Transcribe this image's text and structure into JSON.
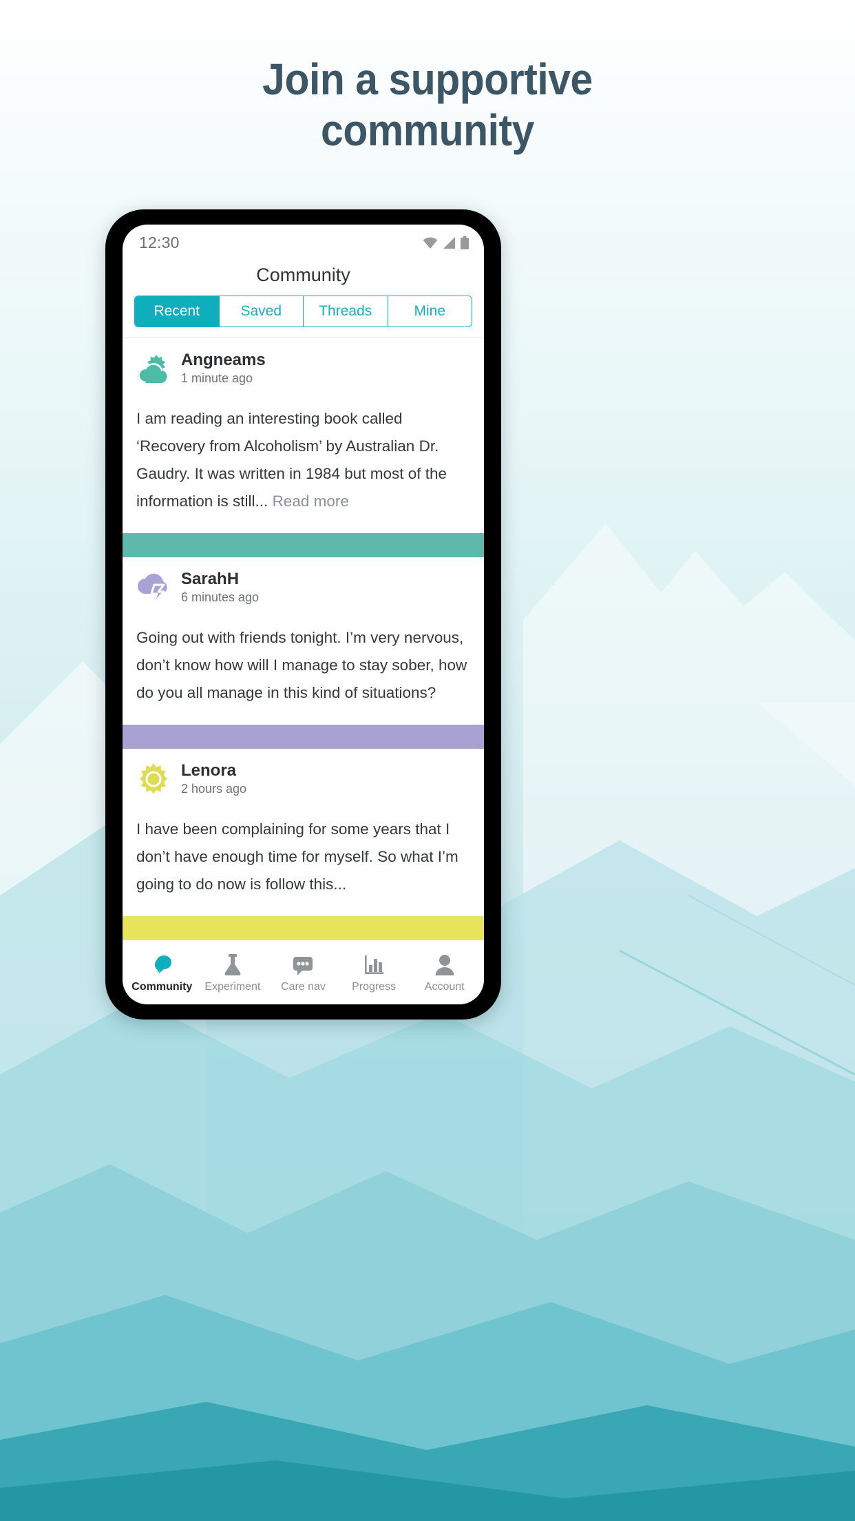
{
  "headline": {
    "line1": "Join a supportive",
    "line2": "community"
  },
  "phone": {
    "statusbar": {
      "time": "12:30",
      "icons": [
        "wifi-icon",
        "cellular-signal-icon",
        "battery-icon"
      ]
    },
    "app_title": "Community",
    "tabs": [
      {
        "label": "Recent",
        "active": true
      },
      {
        "label": "Saved",
        "active": false
      },
      {
        "label": "Threads",
        "active": false
      },
      {
        "label": "Mine",
        "active": false
      }
    ],
    "posts": [
      {
        "author": "Angneams",
        "time": "1 minute ago",
        "avatar_icon": "sun-behind-cloud-icon",
        "avatar_color": "#4CBCA6",
        "body": "I am reading an interesting book called ‘Recovery from Alcoholism’ by Australian Dr. Gaudry. It was written in 1984 but most of the information is still... ",
        "read_more": "Read more",
        "bar_color": "#5FB8AC"
      },
      {
        "author": "SarahH",
        "time": "6 minutes ago",
        "avatar_icon": "storm-cloud-icon",
        "avatar_color": "#A9A2D6",
        "body": "Going out with friends tonight. I’m very nervous, don’t know how will I manage to stay sober, how do you all manage in this kind of situations?",
        "read_more": "",
        "bar_color": "#A7A2D2"
      },
      {
        "author": "Lenora",
        "time": "2 hours ago",
        "avatar_icon": "sun-icon",
        "avatar_color": "#DFDC52",
        "body": "I have been complaining for some years that I don’t have enough time for myself. So what I’m going to do now is follow this...",
        "read_more": "",
        "bar_color": "#E8E45C"
      }
    ],
    "bottom_nav": [
      {
        "label": "Community",
        "icon": "chat-bubbles-icon",
        "active": true
      },
      {
        "label": "Experiment",
        "icon": "flask-icon",
        "active": false
      },
      {
        "label": "Care nav",
        "icon": "message-dots-icon",
        "active": false
      },
      {
        "label": "Progress",
        "icon": "bar-chart-icon",
        "active": false
      },
      {
        "label": "Account",
        "icon": "person-icon",
        "active": false
      }
    ]
  },
  "colors": {
    "accent_teal": "#0FAEBD",
    "heading": "#3c5666",
    "nav_inactive": "#8a8f91"
  }
}
